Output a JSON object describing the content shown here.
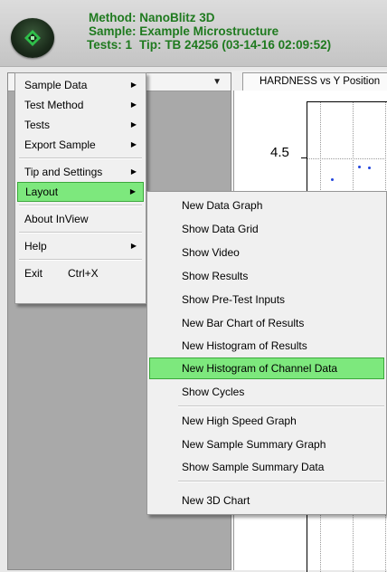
{
  "header": {
    "method_label": "Method:",
    "method_value": "NanoBlitz 3D",
    "sample_label": "Sample:",
    "sample_value": "Example Microstructure",
    "tests_label": "Tests:",
    "tests_value": "1",
    "tip_label": "Tip:",
    "tip_value": "TB 24256 (03-14-16 02:09:52)",
    "accent_color": "#1f7a1f"
  },
  "graph": {
    "tab_title": "HARDNESS vs Y Position",
    "y_tick_label": "4.5"
  },
  "main_menu": {
    "items": [
      {
        "label": "Sample Data",
        "has_submenu": true
      },
      {
        "label": "Test Method",
        "has_submenu": true
      },
      {
        "label": "Tests",
        "has_submenu": true
      },
      {
        "label": "Export Sample",
        "has_submenu": true
      },
      {
        "label": "Tip and Settings",
        "has_submenu": true
      },
      {
        "label": "Layout",
        "has_submenu": true,
        "highlighted": true
      },
      {
        "label": "About InView",
        "has_submenu": false
      },
      {
        "label": "Help",
        "has_submenu": true
      },
      {
        "label": "Exit",
        "has_submenu": false,
        "shortcut": "Ctrl+X"
      }
    ]
  },
  "layout_submenu": {
    "items": [
      {
        "label": "New Data Graph"
      },
      {
        "label": "Show Data Grid"
      },
      {
        "label": "Show Video"
      },
      {
        "label": "Show Results"
      },
      {
        "label": "Show Pre-Test Inputs"
      },
      {
        "label": "New Bar Chart of Results"
      },
      {
        "label": "New Histogram of Results"
      },
      {
        "label": "New Histogram of Channel Data",
        "highlighted": true
      },
      {
        "label": "Show Cycles"
      },
      {
        "label": "New High Speed Graph"
      },
      {
        "label": "New Sample Summary Graph"
      },
      {
        "label": "Show Sample Summary Data"
      },
      {
        "label": "New 3D Chart"
      }
    ]
  },
  "highlight_color": "#7de87d"
}
